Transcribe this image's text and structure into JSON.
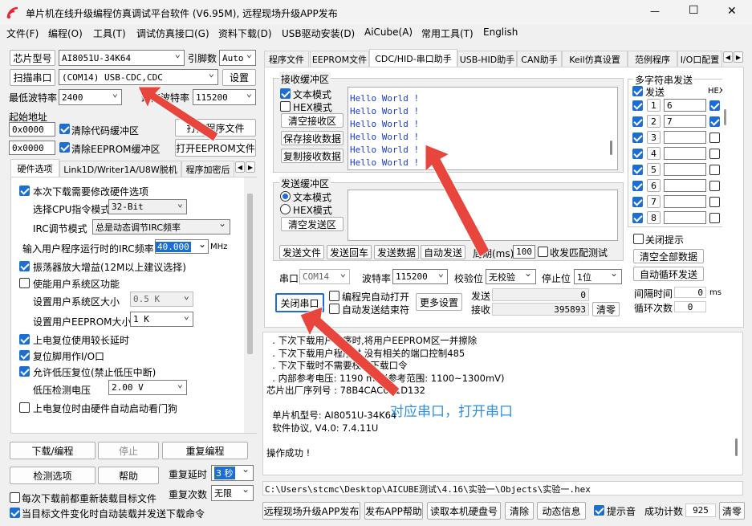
{
  "window": {
    "title": "单片机在线升级编程仿真调试平台软件 (V6.95M), 远程现场升级APP发布",
    "min": "—",
    "max": "☐",
    "close": "✕"
  },
  "menu": [
    "文件(F)",
    "编程(O)",
    "工具(T)",
    "调试仿真接口(G)",
    "资料下载(D)",
    "USB驱动安装(D)",
    "AiCube(A)",
    "常用工具(T)",
    "English"
  ],
  "left": {
    "chip_label": "芯片型号",
    "chip_value": "AI8051U-34K64",
    "pins_label": "引脚数",
    "pins_value": "Auto",
    "scan_button": "扫描串口",
    "port_value": "(COM14) USB-CDC,CDC",
    "settings_button": "设置",
    "min_baud_label": "最低波特率",
    "min_baud": "2400",
    "max_baud_label": "最高波特率",
    "max_baud": "115200",
    "start_addr_label": "起始地址",
    "addr1": "0x0000",
    "clear_code": "清除代码缓冲区",
    "open_prog": "打开程序文件",
    "addr2": "0x0000",
    "clear_eeprom": "清除EEPROM缓冲区",
    "open_eeprom": "打开EEPROM文件",
    "tabs": [
      "硬件选项",
      "Link1D/Writer1A/U8W脱机",
      "程序加密后"
    ],
    "hw": {
      "o1": "本次下载需要修改硬件选项",
      "cpu_label": "选择CPU指令模式",
      "cpu_value": "32-Bit",
      "irc_label": "IRC调节模式",
      "irc_value": "总是动态调节IRC频率",
      "freq_label": "输入用户程序运行时的IRC频率",
      "freq_value": "40.000",
      "freq_unit": "MHz",
      "o2": "振荡器放大增益(12M以上建议选择)",
      "o3": "使能用户系统区功能",
      "sys_label": "设置用户系统区大小",
      "sys_value": "0.5 K",
      "ee_label": "设置用户EEPROM大小",
      "ee_value": "1  K",
      "o4": "上电复位使用较长延时",
      "o5": "复位脚用作I/O口",
      "o6": "允许低压复位(禁止低压中断)",
      "lv_label": "低压检测电压",
      "lv_value": "2.00 V",
      "o7": "上电复位时由硬件自动启动看门狗"
    },
    "download": "下载/编程",
    "stop": "停止",
    "reprogram": "重复编程",
    "check": "检测选项",
    "help": "帮助",
    "delay_label": "重复延时",
    "delay_value": "3 秒",
    "count_label": "重复次数",
    "count_value": "无限",
    "auto1": "每次下载前都重新装载目标文件",
    "auto2": "当目标文件变化时自动装载并发送下载命令"
  },
  "tabs": [
    "程序文件",
    "EEPROM文件",
    "CDC/HID-串口助手",
    "USB-HID助手",
    "CAN助手",
    "Keil仿真设置",
    "范例程序",
    "I/O口配置"
  ],
  "recv": {
    "title": "接收缓冲区",
    "text_mode": "文本模式",
    "hex_mode": "HEX模式",
    "clear": "清空接收区",
    "save": "保存接收数据",
    "copy": "复制接收数据",
    "lines": [
      "Hello World !",
      "Hello World !",
      "Hello World !",
      "Hello World !",
      "Hello World !",
      "Hello World !"
    ]
  },
  "send": {
    "title": "发送缓冲区",
    "text_mode": "文本模式",
    "hex_mode": "HEX模式",
    "clear": "清空发送区",
    "send_file": "发送文件",
    "send_return": "发送回车",
    "send_data": "发送数据",
    "auto_send": "自动发送",
    "period_label": "周期(ms)",
    "period_value": "100",
    "match": "收发匹配测试"
  },
  "serial": {
    "port_label": "串口",
    "port_value": "COM14",
    "baud_label": "波特率",
    "baud_value": "115200",
    "parity_label": "校验位",
    "parity_value": "无校验",
    "stop_label": "停止位",
    "stop_value": "1位",
    "close_port": "关闭串口",
    "open_after": "编程完自动打开",
    "send_after": "自动发送结束符",
    "more": "更多设置",
    "send_label": "发送",
    "send_count": "0",
    "recv_label": "接收",
    "recv_count": "395893",
    "clear": "清零"
  },
  "multi": {
    "title": "多字符串发送",
    "send_col": "发送",
    "hex_col": "HEX",
    "rows": [
      {
        "n": "1",
        "v": "6"
      },
      {
        "n": "2",
        "v": "7"
      },
      {
        "n": "3",
        "v": ""
      },
      {
        "n": "4",
        "v": ""
      },
      {
        "n": "5",
        "v": ""
      },
      {
        "n": "6",
        "v": ""
      },
      {
        "n": "7",
        "v": ""
      },
      {
        "n": "8",
        "v": ""
      }
    ],
    "close_hint": "关闭提示",
    "clear_all": "清空全部数据",
    "auto_loop": "自动循环发送",
    "interval_label": "间隔时间",
    "interval_value": "0",
    "interval_unit": "ms",
    "loop_label": "循环次数",
    "loop_value": "0"
  },
  "log": [
    "  . 下次下载用户程序时,将用户EEPROM区一并擦除",
    "  . 下次下载用户程序时,没有相关的端口控制485",
    "  . 下次下载时不需要校验下载口令",
    "  . 内部参考电压: 1190 mV (参考范围: 1100~1300mV)",
    "芯片出厂序列号 : 78B4CAC001D132",
    "",
    "  单片机型号: AI8051U-34K64",
    "  软件协议, V4.0: 7.4.11U",
    "",
    "操作成功 !"
  ],
  "annotation": "对应串口，打开串口",
  "path": "C:\\Users\\stcmc\\Desktop\\AICUBE测试\\4.16\\实验一\\Objects\\实验一.hex",
  "bottom": {
    "publish": "远程现场升级APP发布",
    "publish_help": "发布APP帮助",
    "read_disk": "读取本机硬盘号",
    "clear": "清除",
    "dynamic": "动态信息",
    "beep": "提示音",
    "success_label": "成功计数",
    "success_value": "925",
    "reset": "清零"
  },
  "colors": {
    "accent": "#1c6fd1",
    "arrow": "#e8453c",
    "recv_text": "#1a3cc8",
    "annotation": "#2f8fe0"
  }
}
